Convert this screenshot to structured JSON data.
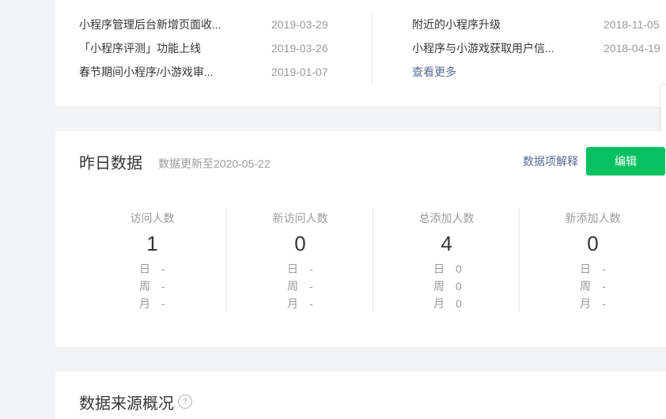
{
  "announcements": {
    "left": [
      {
        "title": "小程序管理后台新增页面收...",
        "date": "2019-03-29"
      },
      {
        "title": "「小程序评测」功能上线",
        "date": "2019-03-26"
      },
      {
        "title": "春节期间小程序/小游戏审...",
        "date": "2019-01-07"
      }
    ],
    "right": [
      {
        "title": "附近的小程序升级",
        "date": "2018-11-05"
      },
      {
        "title": "小程序与小游戏获取用户信...",
        "date": "2018-04-19"
      }
    ],
    "more_label": "查看更多"
  },
  "yesterday": {
    "title": "昨日数据",
    "update_note": "数据更新至2020-05-22",
    "explain_label": "数据项解释",
    "edit_label": "编辑",
    "metrics": [
      {
        "label": "访问人数",
        "value": "1",
        "day_key": "日",
        "day_val": "-",
        "week_key": "周",
        "week_val": "-",
        "month_key": "月",
        "month_val": "-"
      },
      {
        "label": "新访问人数",
        "value": "0",
        "day_key": "日",
        "day_val": "-",
        "week_key": "周",
        "week_val": "-",
        "month_key": "月",
        "month_val": "-"
      },
      {
        "label": "总添加人数",
        "value": "4",
        "day_key": "日",
        "day_val": "0",
        "week_key": "周",
        "week_val": "0",
        "month_key": "月",
        "month_val": "0"
      },
      {
        "label": "新添加人数",
        "value": "0",
        "day_key": "日",
        "day_val": "-",
        "week_key": "周",
        "week_val": "-",
        "month_key": "月",
        "month_val": "-"
      }
    ]
  },
  "source_overview": {
    "title": "数据来源概况",
    "help_icon": "?"
  },
  "colors": {
    "accent_green": "#07c160",
    "link_blue": "#576b95",
    "muted_text": "#9a9a9a",
    "page_bg": "#f3f4f6"
  },
  "icons": {
    "help": "question-circle-icon"
  }
}
